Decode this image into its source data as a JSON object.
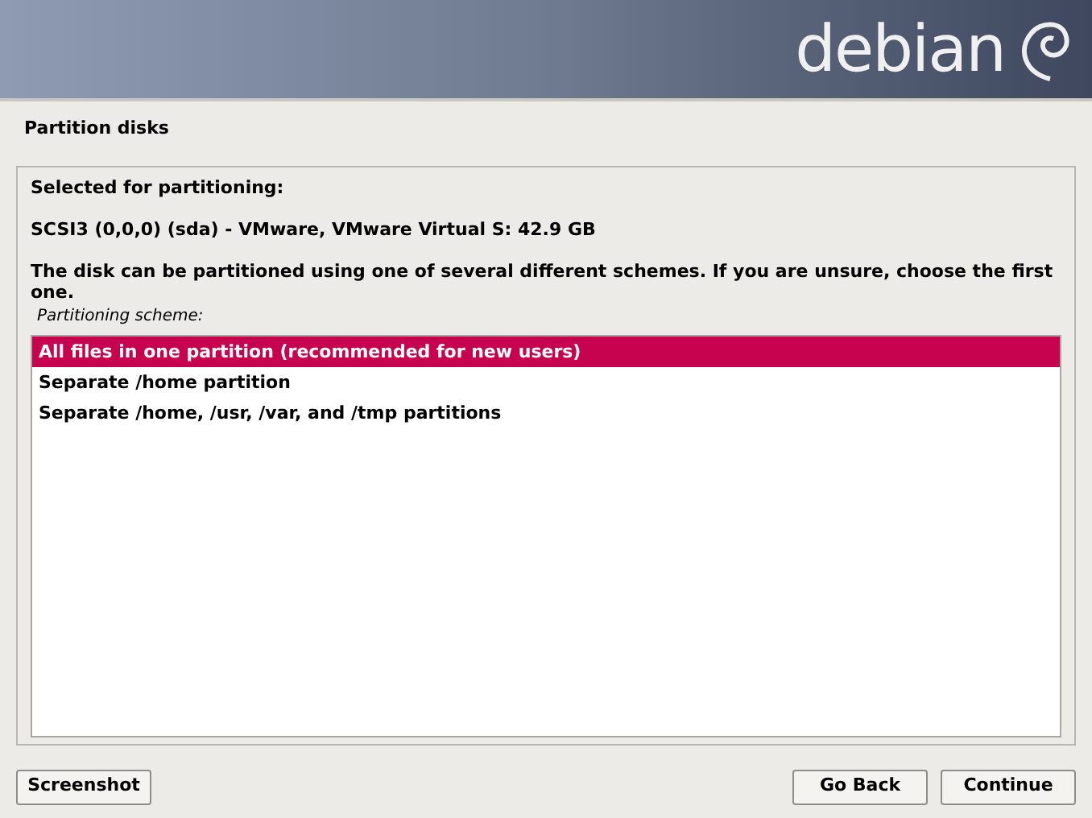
{
  "header": {
    "logo_text": "debian"
  },
  "title": "Partition disks",
  "selected_label": "Selected for partitioning:",
  "disk": "SCSI3 (0,0,0) (sda) - VMware, VMware Virtual S: 42.9 GB",
  "description": "The disk can be partitioned using one of several different schemes. If you are unsure, choose the first one.",
  "list_label": "Partitioning scheme:",
  "options": [
    {
      "label": "All files in one partition (recommended for new users)",
      "selected": true
    },
    {
      "label": "Separate /home partition",
      "selected": false
    },
    {
      "label": "Separate /home, /usr, /var, and /tmp partitions",
      "selected": false
    }
  ],
  "buttons": [
    {
      "label": "Screenshot",
      "kind": "left"
    },
    {
      "label": "Go Back",
      "kind": "right"
    },
    {
      "label": "Continue",
      "kind": "right"
    }
  ]
}
